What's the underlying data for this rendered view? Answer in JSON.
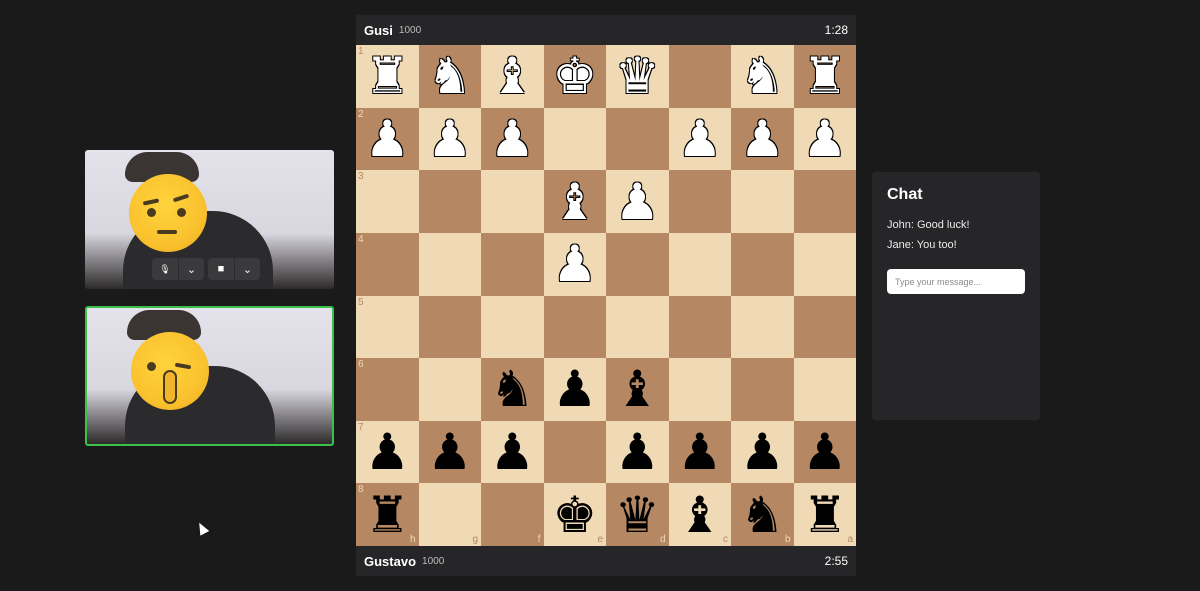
{
  "players": {
    "top": {
      "name": "Gusi",
      "rating": "1000",
      "clock": "1:28"
    },
    "bottom": {
      "name": "Gustavo",
      "rating": "1000",
      "clock": "2:55"
    }
  },
  "board": {
    "ranks": [
      "1",
      "2",
      "3",
      "4",
      "5",
      "6",
      "7",
      "8"
    ],
    "files": [
      "h",
      "g",
      "f",
      "e",
      "d",
      "c",
      "b",
      "a"
    ],
    "position": [
      [
        "wR",
        "wN",
        "wB",
        "wK",
        "wQ",
        "",
        "wN",
        "wR"
      ],
      [
        "wP",
        "wP",
        "wP",
        "",
        "",
        "wP",
        "wP",
        "wP"
      ],
      [
        "",
        "",
        "",
        "wB",
        "wP",
        "",
        "",
        ""
      ],
      [
        "",
        "",
        "",
        "wP",
        "",
        "",
        "",
        ""
      ],
      [
        "",
        "",
        "",
        "",
        "",
        "",
        "",
        ""
      ],
      [
        "",
        "",
        "bN",
        "bP",
        "bB",
        "",
        "",
        ""
      ],
      [
        "bP",
        "bP",
        "bP",
        "",
        "bP",
        "bP",
        "bP",
        "bP"
      ],
      [
        "bR",
        "",
        "",
        "bK",
        "bQ",
        "bB",
        "bN",
        "bR"
      ]
    ],
    "colors": {
      "light": "#f0d9b5",
      "dark": "#b58863"
    }
  },
  "video": {
    "controls": [
      {
        "icon": "microphone-icon",
        "glyph": "🎙"
      },
      {
        "icon": "chevron-down-icon",
        "glyph": "⌄"
      },
      {
        "icon": "video-camera-icon",
        "glyph": "■"
      },
      {
        "icon": "chevron-down-icon",
        "glyph": "⌄"
      }
    ]
  },
  "chat": {
    "title": "Chat",
    "messages": [
      "John: Good luck!",
      "Jane: You too!"
    ],
    "placeholder": "Type your message..."
  }
}
